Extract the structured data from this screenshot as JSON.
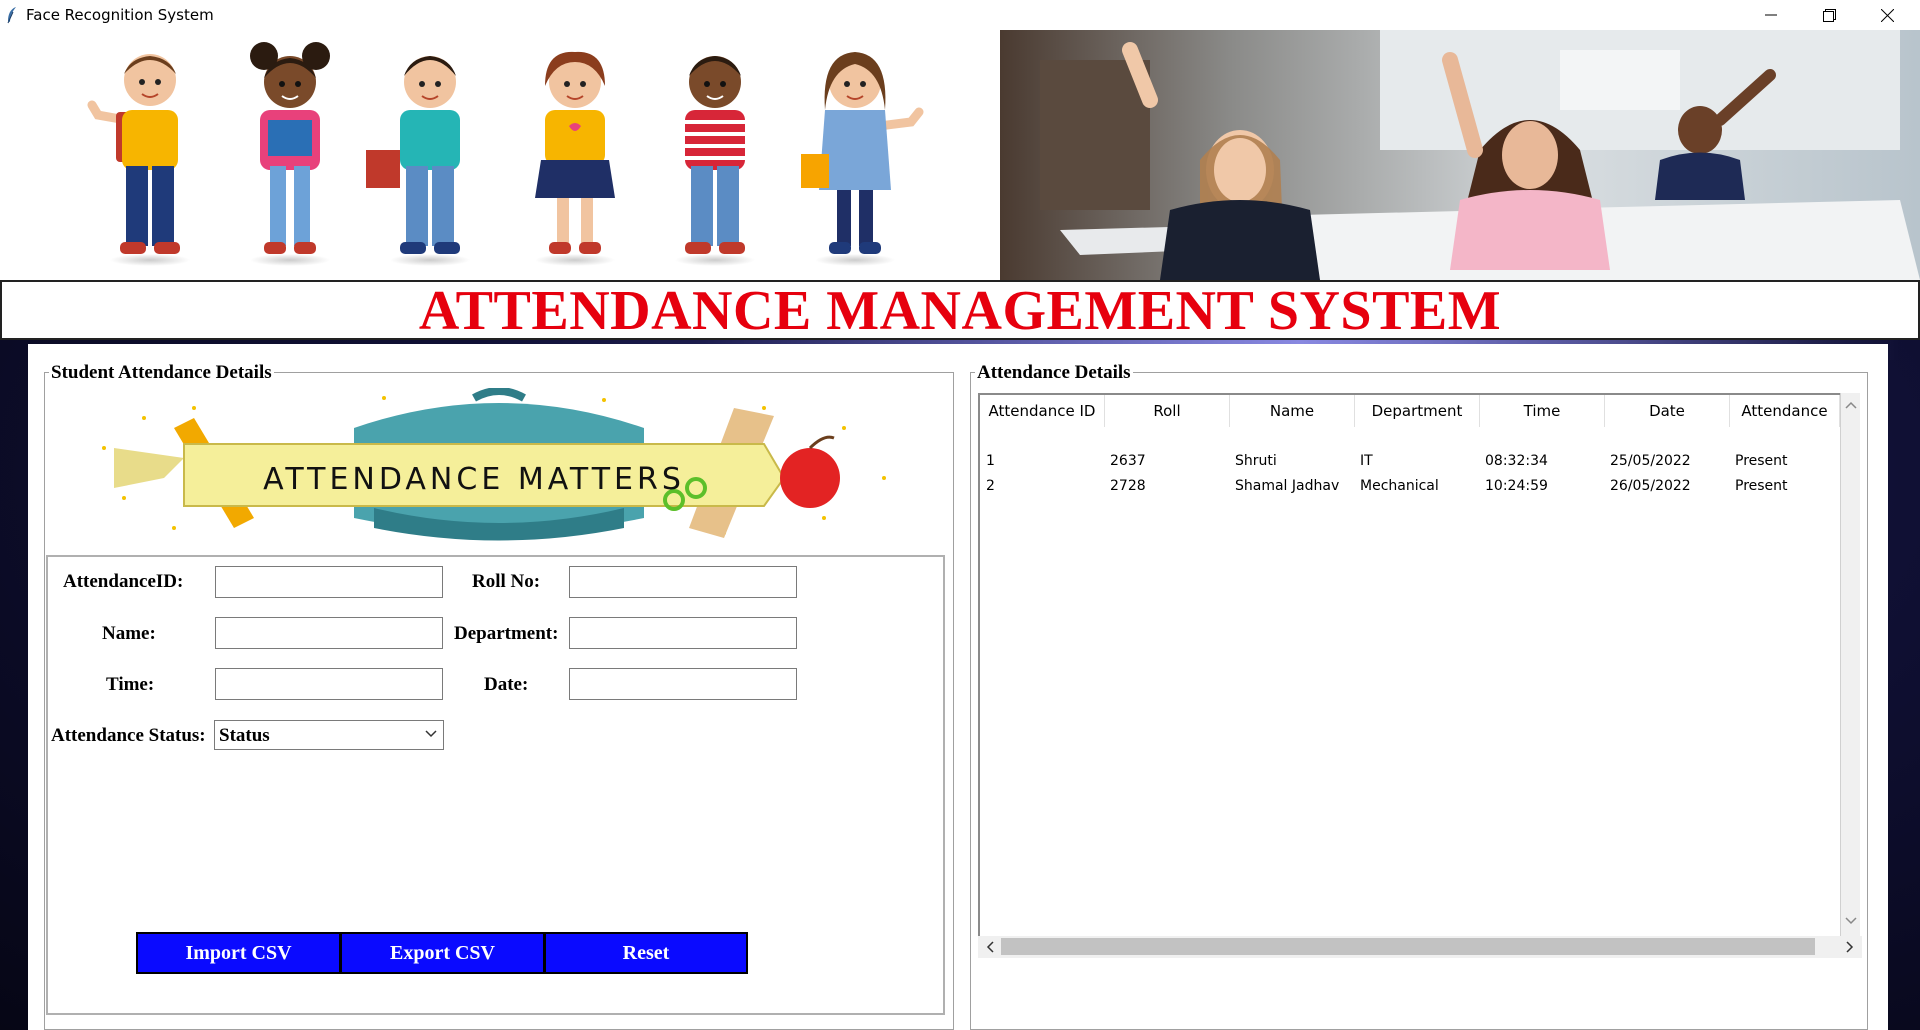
{
  "window": {
    "title": "Face Recognition System"
  },
  "heading": "ATTENDANCE MANAGEMENT SYSTEM",
  "left_panel": {
    "title": "Student Attendance Details",
    "banner_text": "ATTENDANCE MATTERS",
    "fields": {
      "attendance_id": {
        "label": "AttendanceID:",
        "value": ""
      },
      "roll_no": {
        "label": "Roll No:",
        "value": ""
      },
      "name": {
        "label": "Name:",
        "value": ""
      },
      "department": {
        "label": "Department:",
        "value": ""
      },
      "time": {
        "label": "Time:",
        "value": ""
      },
      "date": {
        "label": "Date:",
        "value": ""
      },
      "status": {
        "label": "Attendance Status:",
        "value": "Status"
      }
    },
    "buttons": {
      "import": "Import CSV",
      "export": "Export CSV",
      "reset": "Reset"
    }
  },
  "right_panel": {
    "title": "Attendance Details",
    "columns": [
      "Attendance ID",
      "Roll",
      "Name",
      "Department",
      "Time",
      "Date",
      "Attendance"
    ],
    "rows": [
      [
        "1",
        "2637",
        "Shruti",
        "IT",
        "08:32:34",
        "25/05/2022",
        "Present"
      ],
      [
        "2",
        "2728",
        "Shamal Jadhav",
        "Mechanical",
        "10:24:59",
        "26/05/2022",
        "Present"
      ]
    ]
  },
  "icons": [
    "feather-icon",
    "minimize-icon",
    "maximize-icon",
    "close-icon",
    "chevron-down-icon",
    "scroll-up-icon",
    "scroll-down-icon",
    "scroll-left-icon",
    "scroll-right-icon"
  ],
  "colors": {
    "heading": "#e6000e",
    "button": "#0a0aff",
    "background": "#101035"
  }
}
